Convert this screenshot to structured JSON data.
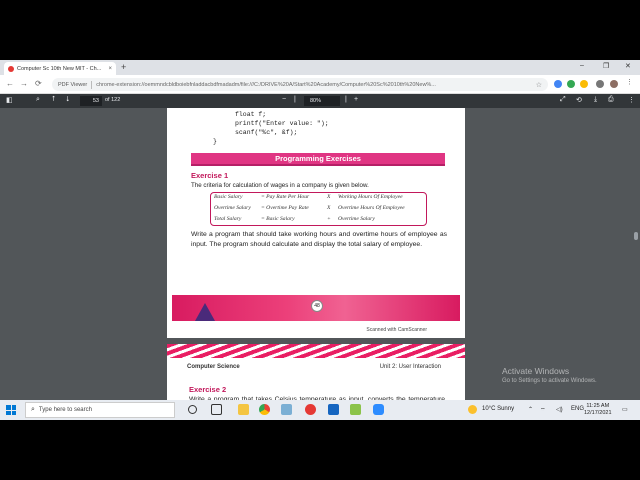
{
  "browser": {
    "tab_title": "Computer Sc 10th New MIT - Ch...",
    "tab_close": "×",
    "new_tab": "+",
    "window_controls": [
      "–",
      "❐",
      "✕"
    ],
    "nav": [
      "←",
      "→",
      "⟳"
    ],
    "site_label": "PDF Viewer",
    "url": "chrome-extension://oemmndcbldboiebfnladdacbdfmadadm/file:///C:/DRIVE%20A/Start%20Academy/Computer%20Sc%2010th%20New%...",
    "star": "☆"
  },
  "pdf_toolbar": {
    "page_current": "53",
    "page_total": "of 122",
    "zoom_minus": "−",
    "zoom_plus": "+",
    "zoom_value": "80%"
  },
  "page1": {
    "code_lines": [
      "float f;",
      "printf(\"Enter value: \");",
      "scanf(\"%c\", &f);",
      "}"
    ],
    "banner": "Programming Exercises",
    "exercise_title": "Exercise 1",
    "exercise_intro": "The criteria for calculation of wages in a company is given below.",
    "formula_rows": [
      {
        "a": "Basic Salary",
        "b": "= Pay Rate Per Hour",
        "op": "X",
        "c": "Working Hours Of Employee"
      },
      {
        "a": "Overtime Salary",
        "b": "= Overtime Pay Rate",
        "op": "X",
        "c": "Overtime Hours Of Employee"
      },
      {
        "a": "Total Salary",
        "b": "= Basic Salary",
        "op": "+",
        "c": "Overtime Salary"
      }
    ],
    "paragraph": "Write a program that should take working hours and overtime hours of employee as input. The program should calculate and display the total salary of employee.",
    "page_number": "48",
    "scanned": "Scanned with CamScanner"
  },
  "page2": {
    "header_left": "Computer Science",
    "header_right": "Unit 2: User Interaction",
    "exercise_title": "Exercise 2",
    "paragraph": "Write a program that takes Celsius temperature as input, converts the temperature into Fahrenheit and shows the output. Formula for conversion of"
  },
  "watermark": {
    "line1": "Activate Windows",
    "line2": "Go to Settings to activate Windows."
  },
  "taskbar": {
    "search_placeholder": "Type here to search",
    "weather": "10°C  Sunny",
    "lang": "ENG",
    "time": "11:25 AM",
    "date": "12/17/2021"
  }
}
